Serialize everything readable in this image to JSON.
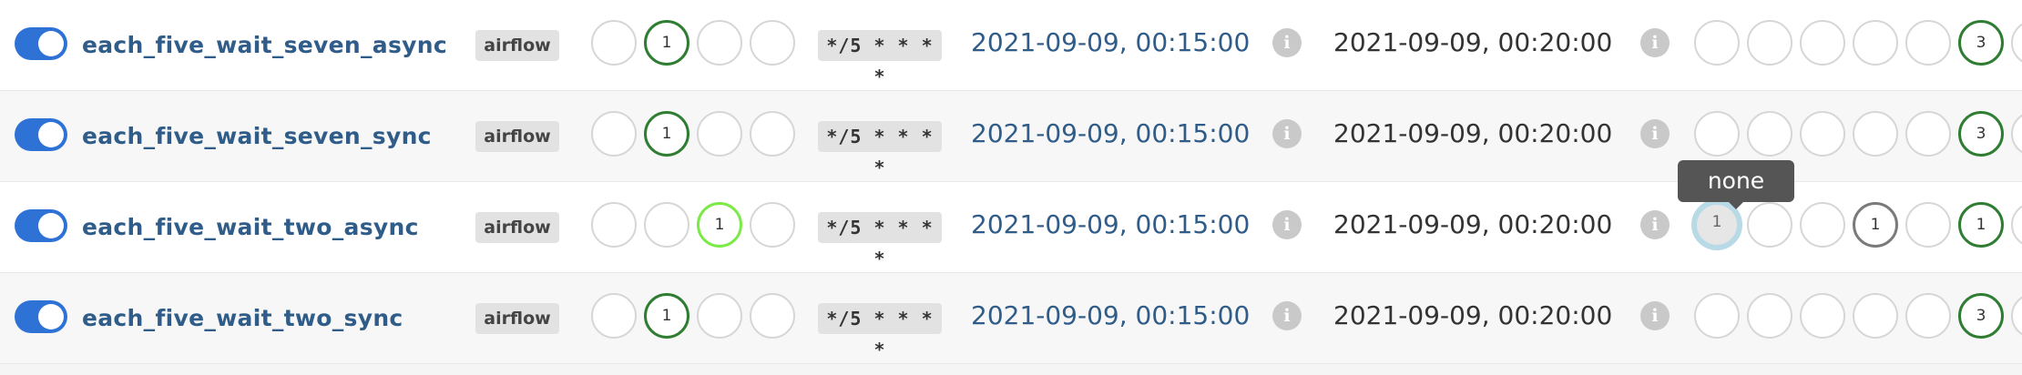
{
  "rows": [
    {
      "dag_id": "each_five_wait_seven_async",
      "owner": "airflow",
      "schedule": "*/5 * * * *",
      "last_run": "2021-09-09, 00:15:00",
      "next_run": "2021-09-09, 00:20:00",
      "dag_run_counts": [
        "",
        "1",
        "",
        ""
      ],
      "task_counts": [
        "",
        "",
        "",
        "",
        "",
        "3",
        ""
      ]
    },
    {
      "dag_id": "each_five_wait_seven_sync",
      "owner": "airflow",
      "schedule": "*/5 * * * *",
      "last_run": "2021-09-09, 00:15:00",
      "next_run": "2021-09-09, 00:20:00",
      "dag_run_counts": [
        "",
        "1",
        "",
        ""
      ],
      "task_counts": [
        "",
        "",
        "",
        "",
        "",
        "3",
        ""
      ]
    },
    {
      "dag_id": "each_five_wait_two_async",
      "owner": "airflow",
      "schedule": "*/5 * * * *",
      "last_run": "2021-09-09, 00:15:00",
      "next_run": "2021-09-09, 00:20:00",
      "dag_run_counts": [
        "",
        "",
        "1",
        ""
      ],
      "task_counts": [
        "1",
        "",
        "",
        "1",
        "",
        "1",
        ""
      ]
    },
    {
      "dag_id": "each_five_wait_two_sync",
      "owner": "airflow",
      "schedule": "*/5 * * * *",
      "last_run": "2021-09-09, 00:15:00",
      "next_run": "2021-09-09, 00:20:00",
      "dag_run_counts": [
        "",
        "1",
        "",
        ""
      ],
      "task_counts": [
        "",
        "",
        "",
        "",
        "",
        "3",
        ""
      ]
    }
  ],
  "tooltip": "none",
  "info_glyph": "i",
  "colors": {
    "toggle_on": "#2f72d6",
    "dag_link": "#2f5c88",
    "success": "#2e7d32",
    "running": "#7bea47",
    "none_state": "#b8d9e6"
  }
}
